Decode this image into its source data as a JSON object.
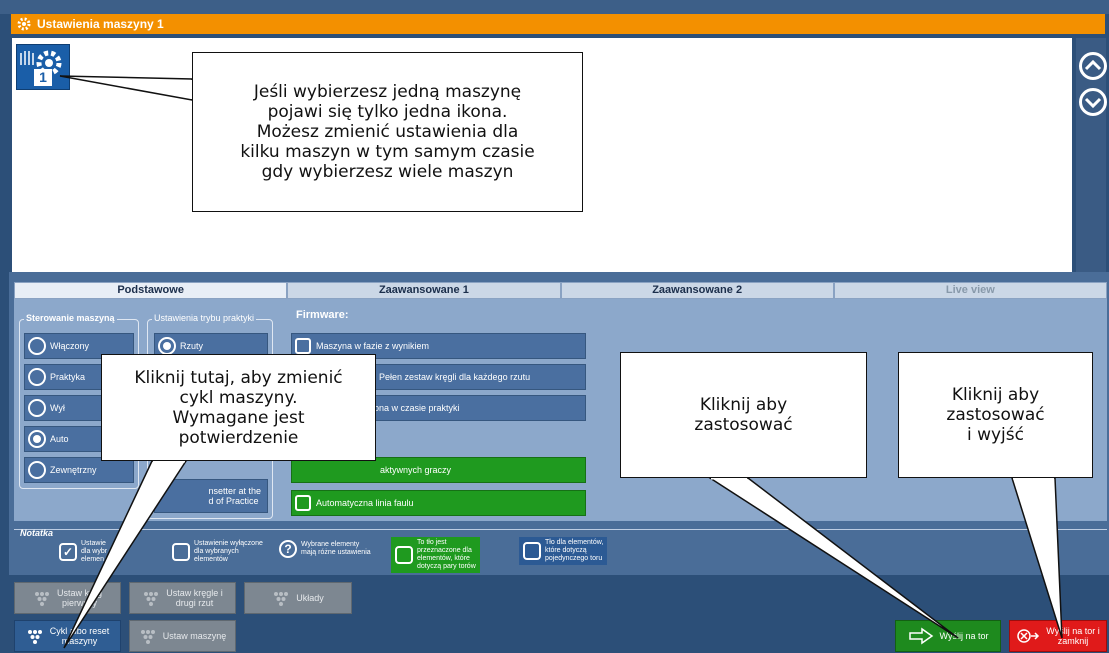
{
  "window": {
    "title": "Ustawienia maszyny 1"
  },
  "machine_icon": {
    "number": "1"
  },
  "tabs": [
    {
      "label": "Podstawowe",
      "state": "active"
    },
    {
      "label": "Zaawansowane 1",
      "state": "normal"
    },
    {
      "label": "Zaawansowane 2",
      "state": "normal"
    },
    {
      "label": "Live view",
      "state": "disabled"
    }
  ],
  "machine_control": {
    "title": "Sterowanie maszyną",
    "options": [
      {
        "label": "Włączony",
        "selected": false
      },
      {
        "label": "Praktyka",
        "selected": false
      },
      {
        "label": "Wył",
        "selected": false
      },
      {
        "label": "Auto",
        "selected": true
      },
      {
        "label": "Zewnętrzny",
        "selected": false
      }
    ]
  },
  "practice_mode": {
    "title": "Ustawienia trybu praktyki",
    "options": [
      {
        "label": "Rzuty",
        "selected": true
      }
    ],
    "bottom_option": "nsetter at the\nd of Practice"
  },
  "firmware": {
    "label": "Firmware:",
    "items": [
      {
        "label": "Maszyna w fazie z wynikiem",
        "style": "blue"
      },
      {
        "label": ": Pełen zestaw kręgli dla każdego rzutu",
        "style": "blue"
      },
      {
        "label": "ona w czasie praktyki",
        "style": "blue"
      },
      {
        "label": "aktywnych graczy",
        "style": "green"
      },
      {
        "label": "Automatyczna linia faulu",
        "style": "green"
      }
    ]
  },
  "notes": {
    "title": "Notatka",
    "items": [
      {
        "label": "Ustawie\ndla wybr\nelemen",
        "style": "plain",
        "symbol": "✓"
      },
      {
        "label": "Ustawienie wyłączone\ndla wybranych\nelementów",
        "style": "plain",
        "symbol": ""
      },
      {
        "label": "Wybrane elementy\nmają różne ustawienia",
        "style": "plain",
        "symbol": "?"
      },
      {
        "label": "To tło jest\nprzeznaczone dla\nelementów, które\ndotyczą pary torów",
        "style": "green",
        "symbol": ""
      },
      {
        "label": "Tło dla elementów,\nktóre dotyczą\npojedynczego toru",
        "style": "blue",
        "symbol": ""
      }
    ]
  },
  "bottom_buttons": {
    "set_pins_first": "Ustaw kręg\npierwszy",
    "set_pins_second": "Ustaw kręgle i\ndrugi rzut",
    "layouts": "Układy",
    "cycle_reset": "Cykl albo reset\nmaszyny",
    "set_machine": "Ustaw maszynę",
    "send_to_lane": "Wyślij na tor",
    "send_and_close": "Wyślij na tor i\nzamknij"
  },
  "callouts": {
    "single_machine": "Jeśli wybierzesz jedną maszynę\npojawi się tylko jedna ikona.\nMożesz zmienić ustawienia dla\nkilku maszyn w tym samym czasie\ngdy wybierzesz wiele maszyn",
    "cycle_machine": "Kliknij tutaj, aby zmienić\ncykl maszyny.\nWymagane jest\npotwierdzenie",
    "apply": "Kliknij aby\nzastosować",
    "apply_exit": "Kliknij aby\nzastosować\ni wyjść"
  },
  "colors": {
    "title_bar": "#f39000",
    "panel": "#8ca8cb",
    "green_button": "#1e8a1e",
    "red_button": "#e01a1a"
  }
}
